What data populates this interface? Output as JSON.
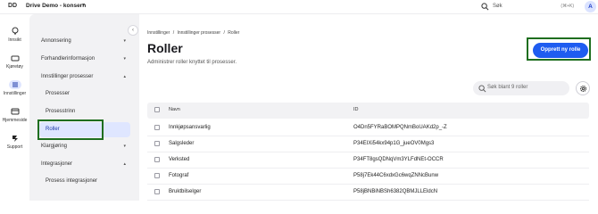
{
  "topbar": {
    "org_initials": "DD",
    "org_name": "Drive Demo - konsern",
    "search_placeholder": "Søk",
    "search_shortcut": "(⌘+K)",
    "user_initial": "A"
  },
  "rail": {
    "items": [
      {
        "label": "Innsikt",
        "icon": "lightbulb-icon"
      },
      {
        "label": "Kjøretøy",
        "icon": "car-icon"
      },
      {
        "label": "Innstillinger",
        "icon": "sliders-icon",
        "active": true
      },
      {
        "label": "Hjemmeside",
        "icon": "browser-icon"
      },
      {
        "label": "Support",
        "icon": "support-icon"
      }
    ]
  },
  "sidebar": {
    "items": [
      {
        "label": "Annonsering",
        "chevron": "▾"
      },
      {
        "label": "Forhandlerinformasjon",
        "chevron": "▾"
      },
      {
        "label": "Innstillinger prosesser",
        "chevron": "▴"
      },
      {
        "label": "Klargjøring",
        "chevron": "▾"
      },
      {
        "label": "Integrasjoner",
        "chevron": "▴"
      }
    ],
    "subitems": [
      {
        "label": "Prosesser"
      },
      {
        "label": "Prosesstrinn"
      },
      {
        "label": "Roller",
        "active": true
      },
      {
        "label": "Prosess integrasjoner"
      }
    ]
  },
  "breadcrumb": [
    "Innstillinger",
    "/",
    "Innstillinger prosesser",
    "/",
    "Roller"
  ],
  "page": {
    "title": "Roller",
    "subtitle": "Administrer roller knyttet til prosesser.",
    "primary_button": "Opprett ny rolle",
    "search_placeholder": "Søk blant 9 roller"
  },
  "table": {
    "columns": [
      "Navn",
      "ID"
    ],
    "rows": [
      {
        "name": "Innkjøpsansvarlig",
        "id": "O4Dn5FYRaBOMPQNmBoUAKd2p_-Z"
      },
      {
        "name": "Salgsleder",
        "id": "P34EIXi54kx94p1G_jueOV0Mgs3"
      },
      {
        "name": "Verksted",
        "id": "P34FT8gsQDNqVm3YLFdNEt-OCCR"
      },
      {
        "name": "Fotograf",
        "id": "P58j7Ek44C6xdxGc6wqZNNcBunw"
      },
      {
        "name": "Bruktbilselger",
        "id": "P58jBNBiNBSh6382QBMJLLEldcN"
      }
    ]
  },
  "colors": {
    "accent": "#1f5cf0",
    "active_bg": "#dfe6ff",
    "highlight_box": "#1f6e1f"
  }
}
